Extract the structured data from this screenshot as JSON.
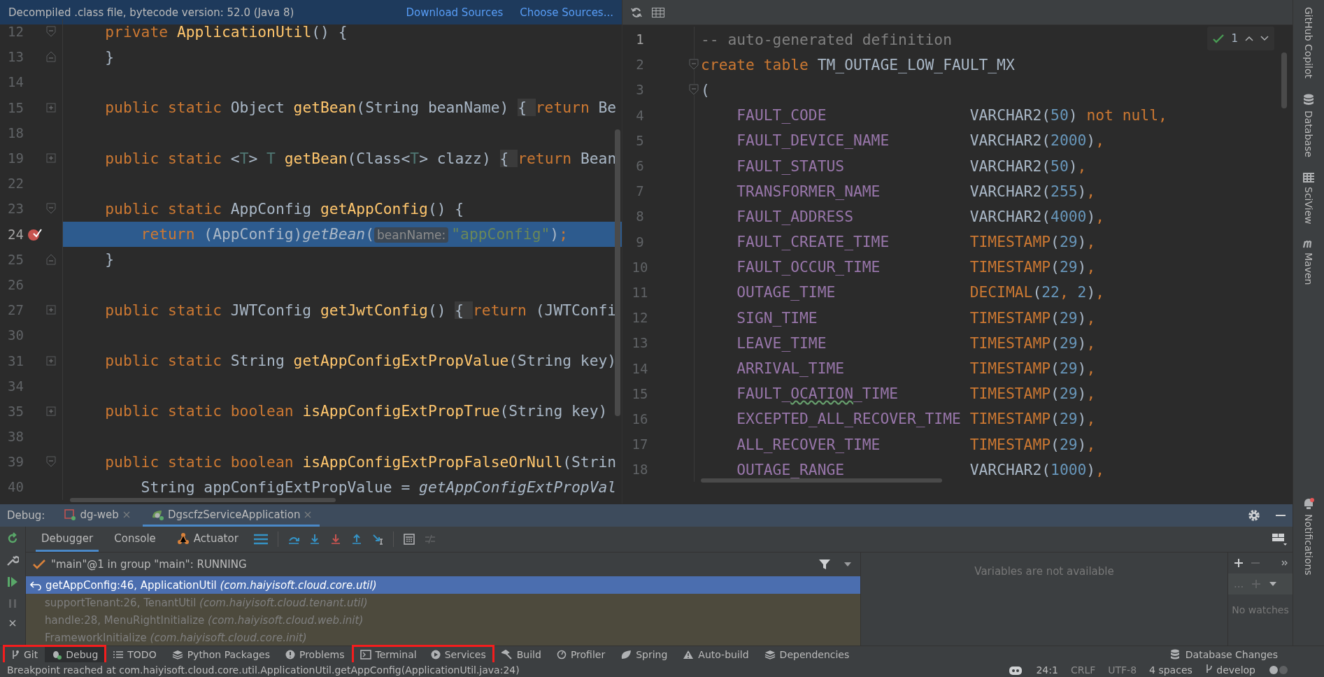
{
  "editor_left": {
    "banner": {
      "text": "Decompiled .class file, bytecode version: 52.0 (Java 8)",
      "links": [
        "Download Sources",
        "Choose Sources..."
      ]
    },
    "lines": [
      {
        "number": "12",
        "kind": "fold-start",
        "breakpoint": false,
        "current": false,
        "tokens": [
          {
            "kind": "keyword",
            "text": "    private "
          },
          {
            "kind": "method",
            "text": "ApplicationUtil"
          },
          {
            "kind": "plain",
            "text": "() {"
          }
        ]
      },
      {
        "number": "13",
        "kind": "fold-end",
        "breakpoint": false,
        "current": false,
        "tokens": [
          {
            "kind": "plain",
            "text": "    }"
          }
        ]
      },
      {
        "number": "14",
        "kind": "plain",
        "breakpoint": false,
        "current": false
      },
      {
        "number": "15",
        "kind": "collapsed",
        "breakpoint": false,
        "current": false,
        "tokens": [
          {
            "kind": "keyword",
            "text": "    public static "
          },
          {
            "kind": "plain",
            "text": "Object "
          },
          {
            "kind": "method",
            "text": "getBean"
          },
          {
            "kind": "plain",
            "text": "(String beanName) "
          },
          {
            "kind": "folded",
            "text": "{ "
          },
          {
            "kind": "keyword",
            "text": "return "
          },
          {
            "kind": "plain",
            "text": "Be"
          }
        ]
      },
      {
        "number": "18",
        "kind": "plain",
        "breakpoint": false,
        "current": false
      },
      {
        "number": "19",
        "kind": "collapsed",
        "breakpoint": false,
        "current": false,
        "tokens": [
          {
            "kind": "keyword",
            "text": "    public static "
          },
          {
            "kind": "plain",
            "text": "<"
          },
          {
            "kind": "typeparam",
            "text": "T"
          },
          {
            "kind": "plain",
            "text": "> "
          },
          {
            "kind": "typeparam",
            "text": "T "
          },
          {
            "kind": "method",
            "text": "getBean"
          },
          {
            "kind": "plain",
            "text": "(Class<"
          },
          {
            "kind": "typeparam",
            "text": "T"
          },
          {
            "kind": "plain",
            "text": "> clazz) "
          },
          {
            "kind": "folded",
            "text": "{ "
          },
          {
            "kind": "keyword",
            "text": "return "
          },
          {
            "kind": "plain",
            "text": "Bean"
          }
        ]
      },
      {
        "number": "22",
        "kind": "plain",
        "breakpoint": false,
        "current": false
      },
      {
        "number": "23",
        "kind": "fold-start",
        "breakpoint": false,
        "current": false,
        "tokens": [
          {
            "kind": "keyword",
            "text": "    public static "
          },
          {
            "kind": "plain",
            "text": "AppConfig "
          },
          {
            "kind": "method",
            "text": "getAppConfig"
          },
          {
            "kind": "plain",
            "text": "() {"
          }
        ]
      },
      {
        "number": "24",
        "kind": "plain",
        "breakpoint": true,
        "current": true,
        "tokens": [
          {
            "kind": "keyword",
            "text": "        return "
          },
          {
            "kind": "plain",
            "text": "(AppConfig)"
          },
          {
            "kind": "call",
            "text": "getBean"
          },
          {
            "kind": "plain",
            "text": "("
          },
          {
            "kind": "hint",
            "text": "beanName:"
          },
          {
            "kind": "string",
            "text": "\"appConfig\""
          },
          {
            "kind": "plain",
            "text": ")"
          },
          {
            "kind": "keyword",
            "text": ";"
          }
        ]
      },
      {
        "number": "25",
        "kind": "fold-end",
        "breakpoint": false,
        "current": false,
        "tokens": [
          {
            "kind": "plain",
            "text": "    }"
          }
        ]
      },
      {
        "number": "26",
        "kind": "plain",
        "breakpoint": false,
        "current": false
      },
      {
        "number": "27",
        "kind": "collapsed",
        "breakpoint": false,
        "current": false,
        "tokens": [
          {
            "kind": "keyword",
            "text": "    public static "
          },
          {
            "kind": "plain",
            "text": "JWTConfig "
          },
          {
            "kind": "method",
            "text": "getJwtConfig"
          },
          {
            "kind": "plain",
            "text": "() "
          },
          {
            "kind": "folded",
            "text": "{ "
          },
          {
            "kind": "keyword",
            "text": "return "
          },
          {
            "kind": "plain",
            "text": "(JWTConfi"
          }
        ]
      },
      {
        "number": "30",
        "kind": "plain",
        "breakpoint": false,
        "current": false
      },
      {
        "number": "31",
        "kind": "collapsed",
        "breakpoint": false,
        "current": false,
        "tokens": [
          {
            "kind": "keyword",
            "text": "    public static "
          },
          {
            "kind": "plain",
            "text": "String "
          },
          {
            "kind": "method",
            "text": "getAppConfigExtPropValue"
          },
          {
            "kind": "plain",
            "text": "(String key)"
          }
        ]
      },
      {
        "number": "34",
        "kind": "plain",
        "breakpoint": false,
        "current": false
      },
      {
        "number": "35",
        "kind": "collapsed",
        "breakpoint": false,
        "current": false,
        "tokens": [
          {
            "kind": "keyword",
            "text": "    public static boolean "
          },
          {
            "kind": "method",
            "text": "isAppConfigExtPropTrue"
          },
          {
            "kind": "plain",
            "text": "(String key)"
          }
        ]
      },
      {
        "number": "38",
        "kind": "plain",
        "breakpoint": false,
        "current": false
      },
      {
        "number": "39",
        "kind": "fold-start",
        "breakpoint": false,
        "current": false,
        "tokens": [
          {
            "kind": "keyword",
            "text": "    public static boolean "
          },
          {
            "kind": "method",
            "text": "isAppConfigExtPropFalseOrNull"
          },
          {
            "kind": "plain",
            "text": "(Strin"
          }
        ]
      },
      {
        "number": "40",
        "kind": "plain",
        "breakpoint": false,
        "current": false,
        "tokens": [
          {
            "kind": "plain",
            "text": "        String appConfigExtPropValue = "
          },
          {
            "kind": "call",
            "text": "getAppConfigExtPropVal"
          }
        ]
      }
    ]
  },
  "editor_right": {
    "inspection_count": "1",
    "lines": [
      {
        "number": "1",
        "kind": "plain",
        "current": true,
        "tokens": [
          {
            "kind": "comment",
            "text": "-- auto-generated definition"
          }
        ]
      },
      {
        "number": "2",
        "kind": "fold-start",
        "current": false,
        "tokens": [
          {
            "kind": "keyword",
            "text": "create table "
          },
          {
            "kind": "plain",
            "text": "TM_OUTAGE_LOW_FAULT_MX"
          }
        ]
      },
      {
        "number": "3",
        "kind": "fold-start",
        "current": false,
        "tokens": [
          {
            "kind": "plain",
            "text": "("
          }
        ]
      },
      {
        "number": "4",
        "kind": "plain",
        "current": false,
        "tokens": [
          {
            "kind": "column",
            "text": "    FAULT_CODE"
          },
          {
            "kind": "plain",
            "text": "                VARCHAR2("
          },
          {
            "kind": "number",
            "text": "50"
          },
          {
            "kind": "plain",
            "text": ") "
          },
          {
            "kind": "keyword",
            "text": "not null,"
          }
        ]
      },
      {
        "number": "5",
        "kind": "plain",
        "current": false,
        "tokens": [
          {
            "kind": "column",
            "text": "    FAULT_DEVICE_NAME"
          },
          {
            "kind": "plain",
            "text": "         VARCHAR2("
          },
          {
            "kind": "number",
            "text": "2000"
          },
          {
            "kind": "plain",
            "text": ")"
          },
          {
            "kind": "keyword",
            "text": ","
          }
        ]
      },
      {
        "number": "6",
        "kind": "plain",
        "current": false,
        "tokens": [
          {
            "kind": "column",
            "text": "    FAULT_STATUS"
          },
          {
            "kind": "plain",
            "text": "              VARCHAR2("
          },
          {
            "kind": "number",
            "text": "50"
          },
          {
            "kind": "plain",
            "text": ")"
          },
          {
            "kind": "keyword",
            "text": ","
          }
        ]
      },
      {
        "number": "7",
        "kind": "plain",
        "current": false,
        "tokens": [
          {
            "kind": "column",
            "text": "    TRANSFORMER_NAME"
          },
          {
            "kind": "plain",
            "text": "          VARCHAR2("
          },
          {
            "kind": "number",
            "text": "255"
          },
          {
            "kind": "plain",
            "text": ")"
          },
          {
            "kind": "keyword",
            "text": ","
          }
        ]
      },
      {
        "number": "8",
        "kind": "plain",
        "current": false,
        "tokens": [
          {
            "kind": "column",
            "text": "    FAULT_ADDRESS"
          },
          {
            "kind": "plain",
            "text": "             VARCHAR2("
          },
          {
            "kind": "number",
            "text": "4000"
          },
          {
            "kind": "plain",
            "text": ")"
          },
          {
            "kind": "keyword",
            "text": ","
          }
        ]
      },
      {
        "number": "9",
        "kind": "plain",
        "current": false,
        "tokens": [
          {
            "kind": "column",
            "text": "    FAULT_CREATE_TIME"
          },
          {
            "kind": "keyword",
            "text": "         TIMESTAMP"
          },
          {
            "kind": "plain",
            "text": "("
          },
          {
            "kind": "number",
            "text": "29"
          },
          {
            "kind": "plain",
            "text": ")"
          },
          {
            "kind": "keyword",
            "text": ","
          }
        ]
      },
      {
        "number": "10",
        "kind": "plain",
        "current": false,
        "tokens": [
          {
            "kind": "column",
            "text": "    FAULT_OCCUR_TIME"
          },
          {
            "kind": "keyword",
            "text": "          TIMESTAMP"
          },
          {
            "kind": "plain",
            "text": "("
          },
          {
            "kind": "number",
            "text": "29"
          },
          {
            "kind": "plain",
            "text": ")"
          },
          {
            "kind": "keyword",
            "text": ","
          }
        ]
      },
      {
        "number": "11",
        "kind": "plain",
        "current": false,
        "tokens": [
          {
            "kind": "column",
            "text": "    OUTAGE_TIME"
          },
          {
            "kind": "keyword",
            "text": "               DECIMAL"
          },
          {
            "kind": "plain",
            "text": "("
          },
          {
            "kind": "number",
            "text": "22"
          },
          {
            "kind": "keyword",
            "text": ", "
          },
          {
            "kind": "number",
            "text": "2"
          },
          {
            "kind": "plain",
            "text": ")"
          },
          {
            "kind": "keyword",
            "text": ","
          }
        ]
      },
      {
        "number": "12",
        "kind": "plain",
        "current": false,
        "tokens": [
          {
            "kind": "column",
            "text": "    SIGN_TIME"
          },
          {
            "kind": "keyword",
            "text": "                 TIMESTAMP"
          },
          {
            "kind": "plain",
            "text": "("
          },
          {
            "kind": "number",
            "text": "29"
          },
          {
            "kind": "plain",
            "text": ")"
          },
          {
            "kind": "keyword",
            "text": ","
          }
        ]
      },
      {
        "number": "13",
        "kind": "plain",
        "current": false,
        "tokens": [
          {
            "kind": "column",
            "text": "    LEAVE_TIME"
          },
          {
            "kind": "keyword",
            "text": "                TIMESTAMP"
          },
          {
            "kind": "plain",
            "text": "("
          },
          {
            "kind": "number",
            "text": "29"
          },
          {
            "kind": "plain",
            "text": ")"
          },
          {
            "kind": "keyword",
            "text": ","
          }
        ]
      },
      {
        "number": "14",
        "kind": "plain",
        "current": false,
        "tokens": [
          {
            "kind": "column",
            "text": "    ARRIVAL_TIME"
          },
          {
            "kind": "keyword",
            "text": "              TIMESTAMP"
          },
          {
            "kind": "plain",
            "text": "("
          },
          {
            "kind": "number",
            "text": "29"
          },
          {
            "kind": "plain",
            "text": ")"
          },
          {
            "kind": "keyword",
            "text": ","
          }
        ]
      },
      {
        "number": "15",
        "kind": "plain",
        "current": false,
        "tokens": [
          {
            "kind": "column",
            "text": "    FAULT_"
          },
          {
            "kind": "typo",
            "text": "OCATION"
          },
          {
            "kind": "column",
            "text": "_TIME"
          },
          {
            "kind": "keyword",
            "text": "        TIMESTAMP"
          },
          {
            "kind": "plain",
            "text": "("
          },
          {
            "kind": "number",
            "text": "29"
          },
          {
            "kind": "plain",
            "text": ")"
          },
          {
            "kind": "keyword",
            "text": ","
          }
        ]
      },
      {
        "number": "16",
        "kind": "plain",
        "current": false,
        "tokens": [
          {
            "kind": "column",
            "text": "    EXCEPTED_ALL_RECOVER_TIME"
          },
          {
            "kind": "keyword",
            "text": " TIMESTAMP"
          },
          {
            "kind": "plain",
            "text": "("
          },
          {
            "kind": "number",
            "text": "29"
          },
          {
            "kind": "plain",
            "text": ")"
          },
          {
            "kind": "keyword",
            "text": ","
          }
        ]
      },
      {
        "number": "17",
        "kind": "plain",
        "current": false,
        "tokens": [
          {
            "kind": "column",
            "text": "    ALL_RECOVER_TIME"
          },
          {
            "kind": "keyword",
            "text": "          TIMESTAMP"
          },
          {
            "kind": "plain",
            "text": "("
          },
          {
            "kind": "number",
            "text": "29"
          },
          {
            "kind": "plain",
            "text": ")"
          },
          {
            "kind": "keyword",
            "text": ","
          }
        ]
      },
      {
        "number": "18",
        "kind": "plain",
        "current": false,
        "tokens": [
          {
            "kind": "column",
            "text": "    OUTAGE_RANGE"
          },
          {
            "kind": "plain",
            "text": "              VARCHAR2("
          },
          {
            "kind": "number",
            "text": "1000"
          },
          {
            "kind": "plain",
            "text": ")"
          },
          {
            "kind": "keyword",
            "text": ","
          }
        ]
      }
    ]
  },
  "side_stripe": {
    "top": [
      "GitHub Copilot",
      "Database",
      "SciView",
      "Maven"
    ],
    "bottom": [
      "Notifications"
    ]
  },
  "debug": {
    "label": "Debug:",
    "tabs": [
      {
        "label": "dg-web",
        "selected": false
      },
      {
        "label": "DgscfzServiceApplication",
        "selected": true
      }
    ],
    "subtabs": [
      {
        "label": "Debugger",
        "selected": true
      },
      {
        "label": "Console",
        "selected": false
      },
      {
        "label": "Actuator",
        "selected": false
      }
    ],
    "thread": "\"main\"@1 in group \"main\": RUNNING",
    "frames": [
      {
        "text": "getAppConfig:46, ApplicationUtil *(com.haiyisoft.cloud.core.util)*",
        "selected": true
      },
      {
        "text": "supportTenant:26, TenantUtil *(com.haiyisoft.cloud.tenant.util)*",
        "selected": false
      },
      {
        "text": "handle:28, MenuRightInitialize *(com.haiyisoft.cloud.web.init)*",
        "selected": false
      },
      {
        "text": "FrameworkInitialize *(com.haiyisoft.cloud.core.init)*",
        "selected": false
      }
    ],
    "variables_message": "Variables are not available",
    "watches_toolbar_text": "...",
    "watches_message": "No watches"
  },
  "tool_windows": [
    {
      "label": "Git",
      "selected": false,
      "circled": true
    },
    {
      "label": "Debug",
      "selected": true,
      "circled": true
    },
    {
      "label": "TODO",
      "selected": false,
      "circled": false
    },
    {
      "label": "Python Packages",
      "selected": false,
      "circled": false
    },
    {
      "label": "Problems",
      "selected": false,
      "circled": false
    },
    {
      "label": "Terminal",
      "selected": false,
      "circled": true
    },
    {
      "label": "Services",
      "selected": false,
      "circled": true
    },
    {
      "label": "Build",
      "selected": false,
      "circled": false
    },
    {
      "label": "Profiler",
      "selected": false,
      "circled": false
    },
    {
      "label": "Spring",
      "selected": false,
      "circled": false
    },
    {
      "label": "Auto-build",
      "selected": false,
      "circled": false
    },
    {
      "label": "Dependencies",
      "selected": false,
      "circled": false
    }
  ],
  "tool_windows_right": "Database Changes",
  "status_bar": {
    "message": "Breakpoint reached at com.haiyisoft.cloud.core.util.ApplicationUtil.getAppConfig(ApplicationUtil.java:24)",
    "items": [
      "24:1",
      "CRLF",
      "UTF-8",
      "4 spaces",
      "develop"
    ]
  }
}
